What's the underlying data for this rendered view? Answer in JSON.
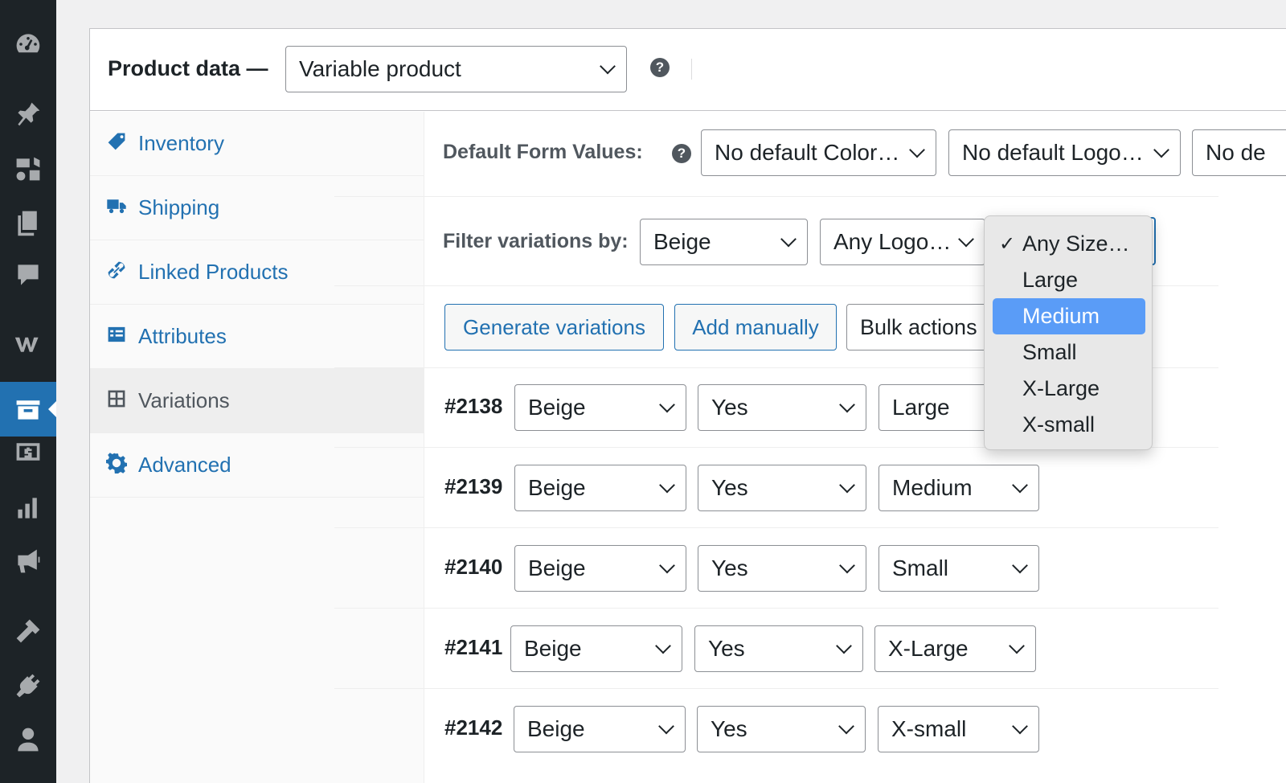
{
  "admin_menu": [
    {
      "icon": "dashboard-icon"
    },
    {
      "icon": "pin-icon"
    },
    {
      "icon": "media-icon"
    },
    {
      "icon": "pages-icon"
    },
    {
      "icon": "comments-icon"
    },
    {
      "icon": "woocommerce-icon"
    },
    {
      "icon": "products-icon",
      "active": true
    },
    {
      "icon": "payments-icon"
    },
    {
      "icon": "analytics-icon"
    },
    {
      "icon": "marketing-icon"
    },
    {
      "icon": "appearance-icon"
    },
    {
      "icon": "plugins-icon"
    },
    {
      "icon": "users-icon"
    }
  ],
  "header": {
    "title": "Product data —",
    "product_type": "Variable product",
    "help": "?"
  },
  "tabs": [
    {
      "label": "Inventory",
      "icon": "tag-icon"
    },
    {
      "label": "Shipping",
      "icon": "truck-icon"
    },
    {
      "label": "Linked Products",
      "icon": "link-icon"
    },
    {
      "label": "Attributes",
      "icon": "list-icon"
    },
    {
      "label": "Variations",
      "icon": "grid-icon",
      "active": true
    },
    {
      "label": "Advanced",
      "icon": "gear-icon"
    }
  ],
  "defaults": {
    "label": "Default Form Values:",
    "help": "?",
    "color": "No default Color…",
    "logo": "No default Logo…",
    "size": "No de"
  },
  "filter": {
    "label": "Filter variations by:",
    "color": "Beige",
    "logo": "Any Logo…",
    "size_options": [
      "Any Size…",
      "Large",
      "Medium",
      "Small",
      "X-Large",
      "X-small"
    ],
    "size_checked": "Any Size…",
    "size_highlighted": "Medium",
    "check_mark": "✓"
  },
  "actions": {
    "generate": "Generate variations",
    "add_manually": "Add manually",
    "bulk": "Bulk actions"
  },
  "variations": [
    {
      "id": "#2138",
      "color": "Beige",
      "logo": "Yes",
      "size": "Large"
    },
    {
      "id": "#2139",
      "color": "Beige",
      "logo": "Yes",
      "size": "Medium"
    },
    {
      "id": "#2140",
      "color": "Beige",
      "logo": "Yes",
      "size": "Small"
    },
    {
      "id": "#2141",
      "color": "Beige",
      "logo": "Yes",
      "size": "X-Large"
    },
    {
      "id": "#2142",
      "color": "Beige",
      "logo": "Yes",
      "size": "X-small"
    }
  ],
  "colors": {
    "admin_bg": "#1d2327",
    "accent": "#2271b1",
    "highlight": "#5a9cf7"
  }
}
